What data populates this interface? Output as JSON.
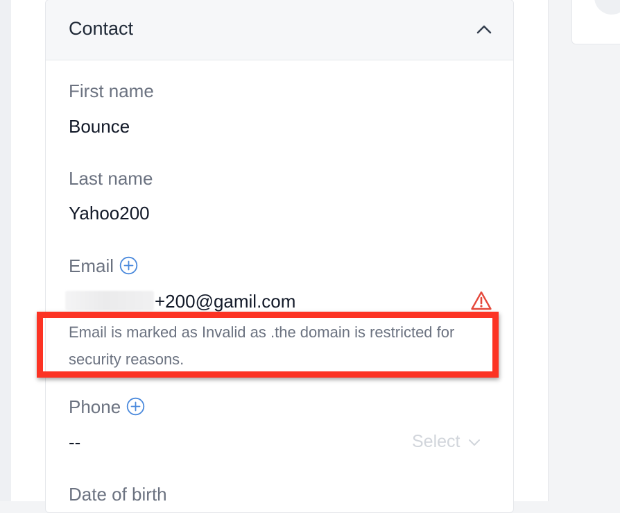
{
  "contact": {
    "title": "Contact",
    "fields": {
      "first_name": {
        "label": "First name",
        "value": "Bounce"
      },
      "last_name": {
        "label": "Last name",
        "value": "Yahoo200"
      },
      "email": {
        "label": "Email",
        "value_visible": "+200@gamil.com",
        "error": "Email is marked as Invalid as .the domain is restricted for security reasons."
      },
      "phone": {
        "label": "Phone",
        "value": "--",
        "select_placeholder": "Select"
      },
      "date_of_birth": {
        "label": "Date of birth"
      }
    }
  },
  "colors": {
    "highlight": "#fc3324",
    "warning": "#e5483b",
    "accent": "#4a89dc"
  },
  "icons": {
    "collapse": "chevron-up-icon",
    "add": "plus-circle-icon",
    "warning": "warning-triangle-icon",
    "dropdown": "chevron-down-icon"
  }
}
